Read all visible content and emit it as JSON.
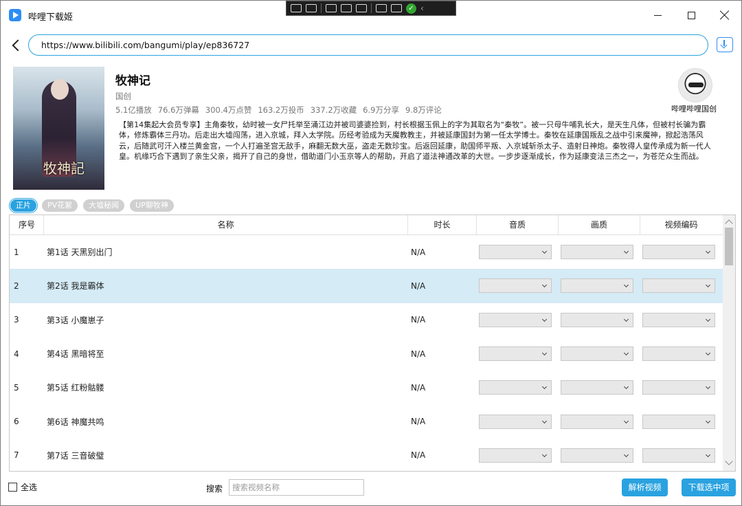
{
  "window": {
    "title": "哔哩下载姬"
  },
  "url_bar": {
    "value": "https://www.bilibili.com/bangumi/play/ep836727"
  },
  "show": {
    "title": "牧神记",
    "category": "国创",
    "cover_text": "牧神記",
    "stats": [
      "5.1亿播放",
      "76.6万弹幕",
      "300.4万点赞",
      "163.2万投币",
      "337.2万收藏",
      "6.9万分享",
      "9.8万评论"
    ],
    "description": "【第14集起大会员专享】主角秦牧，幼时被一女尸托举至涌江边并被司婆婆捡到，村长根据玉佩上的字为其取名为“秦牧”。被一只母牛哺乳长大，是天生凡体，但被村长骗为霸体，修炼霸体三丹功。后走出大墟闯荡，进入京城，拜入太学院。历经考验成为天魔教教主，并被延康国封为第一任太学博士。秦牧在延康国叛乱之战中引来魔神，掀起浩荡风云，后随武可汗入楼兰黄金宫，一个人打遍圣宫无敌手，麻翻无数大巫，盗走无数珍宝。后返回延康，助国师平叛、入京城斩杀太子、造射日神炮。秦牧得人皇传承成为新一代人皇。机缘巧合下遇到了亲生父亲，揭开了自己的身世，借助道门小玉京等人的帮助，开启了道法神通改革的大世。一步步逐渐成长，作为延康变法三杰之一，为苍茫众生而战。",
    "author": "哔哩哔哩国创"
  },
  "tabs": [
    {
      "label": "正片",
      "active": true
    },
    {
      "label": "PV花絮",
      "active": false
    },
    {
      "label": "大墟秘闻",
      "active": false
    },
    {
      "label": "UP聊牧神",
      "active": false
    }
  ],
  "table": {
    "columns": [
      "序号",
      "名称",
      "时长",
      "音质",
      "画质",
      "视频编码"
    ],
    "rows": [
      {
        "index": "1",
        "name": "第1话 天黑别出门",
        "duration": "N/A"
      },
      {
        "index": "2",
        "name": "第2话 我是霸体",
        "duration": "N/A"
      },
      {
        "index": "3",
        "name": "第3话 小魔崽子",
        "duration": "N/A"
      },
      {
        "index": "4",
        "name": "第4话 黑暗将至",
        "duration": "N/A"
      },
      {
        "index": "5",
        "name": "第5话 红粉骷髅",
        "duration": "N/A"
      },
      {
        "index": "6",
        "name": "第6话 神魔共鸣",
        "duration": "N/A"
      },
      {
        "index": "7",
        "name": "第7话 三音破璧",
        "duration": "N/A"
      }
    ],
    "selected_row": "2"
  },
  "footer": {
    "select_all_label": "全选",
    "search_label": "搜索",
    "search_placeholder": "搜索视频名称",
    "parse_button": "解析视频",
    "download_button": "下载选中项"
  },
  "colors": {
    "accent": "#2aa2e0",
    "selected_row": "#d5ebf6",
    "tab_inactive": "#d0d0d0"
  }
}
